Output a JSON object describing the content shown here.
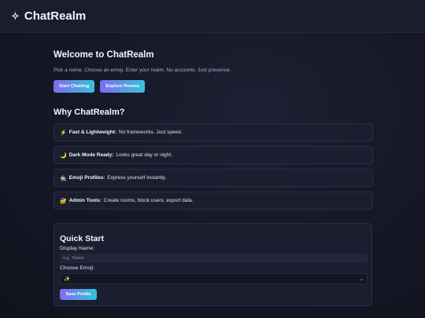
{
  "header": {
    "icon": "sparkle-icon",
    "icon_glyph": "✧",
    "title": "ChatRealm"
  },
  "welcome": {
    "title": "Welcome to ChatRealm",
    "subtitle": "Pick a name. Choose an emoji. Enter your realm. No accounts. Just presence.",
    "buttons": [
      "Start Chatting",
      "Explore Rooms"
    ]
  },
  "why": {
    "title": "Why ChatRealm?",
    "features": [
      {
        "emoji": "⚡",
        "name": "Fast & Lightweight:",
        "text": "No frameworks. Just speed."
      },
      {
        "emoji": "🌙",
        "name": "Dark Mode Ready:",
        "text": "Looks great day or night."
      },
      {
        "emoji": "🧙",
        "name": "Emoji Profiles:",
        "text": "Express yourself instantly."
      },
      {
        "emoji": "🔐",
        "name": "Admin Tools:",
        "text": "Create rooms, block users, export data."
      }
    ]
  },
  "quick_start": {
    "title": "Quick Start",
    "display_name_label": "Display Name:",
    "display_name_placeholder": "e.g., Daniel",
    "display_name_value": "",
    "emoji_label": "Choose Emoji:",
    "emoji_selected": "✨",
    "save_label": "Save Profile"
  },
  "colors": {
    "accent_start": "#7f6cf0",
    "accent_end": "#36c2dc",
    "background": "#151726",
    "card": "#1b1e2f"
  }
}
